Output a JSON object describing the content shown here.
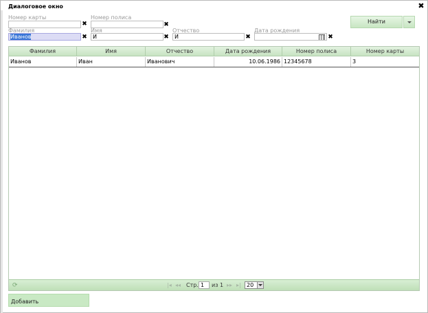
{
  "window": {
    "title": "Диалоговое окно",
    "close_symbol": "✖"
  },
  "filters": {
    "card_number": {
      "label": "Номер карты",
      "value": ""
    },
    "policy_number": {
      "label": "Номер полиса",
      "value": ""
    },
    "last_name": {
      "label": "Фамилия",
      "value": "Иванов"
    },
    "first_name": {
      "label": "Имя",
      "value": "И"
    },
    "patronymic": {
      "label": "Отчество",
      "value": "И"
    },
    "birth_date": {
      "label": "Дата рождения",
      "value": ""
    },
    "clear_symbol": "✖"
  },
  "toolbar": {
    "find_label": "Найти"
  },
  "grid": {
    "columns": [
      "Фамилия",
      "Имя",
      "Отчество",
      "Дата рождения",
      "Номер полиса",
      "Номер карты"
    ],
    "rows": [
      [
        "Иванов",
        "Иван",
        "Иванович",
        "10.06.1986",
        "12345678",
        "3"
      ]
    ]
  },
  "pager": {
    "first": "|◂",
    "prev": "◂◂",
    "page_label": "Стр.",
    "page_value": "1",
    "of_label": "из 1",
    "next": "▸▸",
    "last": "▸|",
    "page_size": "20",
    "refresh_symbol": "⟳"
  },
  "actions": {
    "add_label": "Добавить"
  }
}
